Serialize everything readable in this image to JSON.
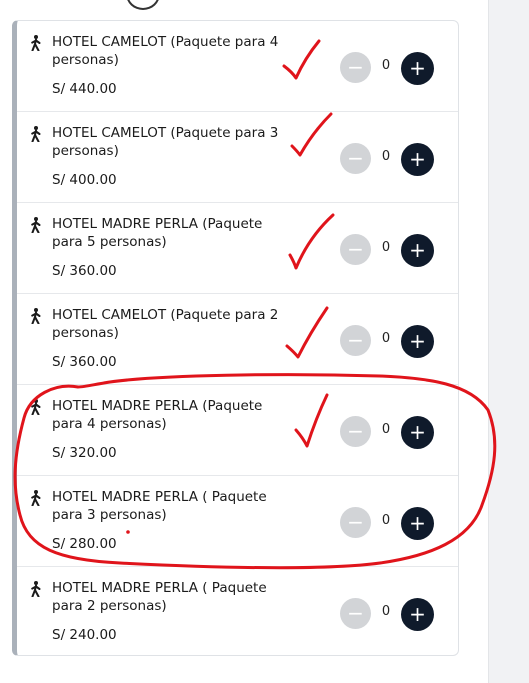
{
  "currency_prefix": "S/",
  "items": [
    {
      "name": "HOTEL CAMELOT (Paquete para 4 personas)",
      "price": "S/ 440.00",
      "qty": "0",
      "minus": "−",
      "plus": "+"
    },
    {
      "name": "HOTEL CAMELOT (Paquete para 3 personas)",
      "price": "S/ 400.00",
      "qty": "0",
      "minus": "−",
      "plus": "+"
    },
    {
      "name": "HOTEL MADRE PERLA (Paquete para 5 personas)",
      "price": "S/ 360.00",
      "qty": "0",
      "minus": "−",
      "plus": "+"
    },
    {
      "name": "HOTEL CAMELOT (Paquete para 2 personas)",
      "price": "S/ 360.00",
      "qty": "0",
      "minus": "−",
      "plus": "+"
    },
    {
      "name": "HOTEL MADRE PERLA (Paquete para 4 personas)",
      "price": "S/ 320.00",
      "qty": "0",
      "minus": "−",
      "plus": "+"
    },
    {
      "name": "HOTEL MADRE PERLA ( Paquete para 3 personas)",
      "price": "S/ 280.00",
      "qty": "0",
      "minus": "−",
      "plus": "+"
    },
    {
      "name": "HOTEL MADRE PERLA ( Paquete para 2 personas)",
      "price": "S/ 240.00",
      "qty": "0",
      "minus": "−",
      "plus": "+"
    }
  ],
  "icons": {
    "row_icon": "walking-person-icon",
    "minus": "minus-icon",
    "plus": "plus-icon"
  },
  "colors": {
    "plus_button": "#0f1a2b",
    "minus_button_disabled": "#d2d4d7",
    "card_left_border": "#aab1ba",
    "annotation_red": "#e0141b"
  },
  "annotations": {
    "checkmarks_on_items": [
      1,
      2,
      3,
      4,
      5
    ],
    "circled_items": [
      5,
      6
    ]
  }
}
